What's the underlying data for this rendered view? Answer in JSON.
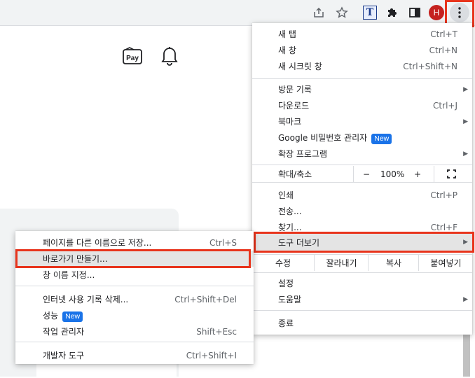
{
  "toolbar": {
    "icons": [
      "share-icon",
      "star-icon",
      "translate-extension-icon",
      "extensions-puzzle-icon",
      "side-panel-icon"
    ],
    "avatar_letter": "H",
    "menu_icon": "kebab-menu-icon",
    "translate_letter": "T"
  },
  "page": {
    "pay_label": "Pay"
  },
  "main_menu": {
    "new_tab": {
      "label": "새 탭",
      "shortcut": "Ctrl+T"
    },
    "new_window": {
      "label": "새 창",
      "shortcut": "Ctrl+N"
    },
    "incognito": {
      "label": "새 시크릿 창",
      "shortcut": "Ctrl+Shift+N"
    },
    "history": {
      "label": "방문 기록"
    },
    "downloads": {
      "label": "다운로드",
      "shortcut": "Ctrl+J"
    },
    "bookmarks": {
      "label": "북마크"
    },
    "password_manager": {
      "label": "Google 비밀번호 관리자",
      "badge": "New"
    },
    "extensions": {
      "label": "확장 프로그램"
    },
    "zoom": {
      "label": "확대/축소",
      "minus": "−",
      "value": "100%",
      "plus": "+"
    },
    "print": {
      "label": "인쇄",
      "shortcut": "Ctrl+P"
    },
    "cast": {
      "label": "전송..."
    },
    "find": {
      "label": "찾기...",
      "shortcut": "Ctrl+F"
    },
    "more_tools": {
      "label": "도구 더보기"
    },
    "edit": {
      "label": "수정",
      "cut": "잘라내기",
      "copy": "복사",
      "paste": "붙여넣기"
    },
    "settings": {
      "label": "설정"
    },
    "help": {
      "label": "도움말"
    },
    "exit": {
      "label": "종료"
    }
  },
  "sub_menu": {
    "save_page": {
      "label": "페이지를 다른 이름으로 저장...",
      "shortcut": "Ctrl+S"
    },
    "create_shortcut": {
      "label": "바로가기 만들기..."
    },
    "name_window": {
      "label": "창 이름 지정..."
    },
    "clear_data": {
      "label": "인터넷 사용 기록 삭제...",
      "shortcut": "Ctrl+Shift+Del"
    },
    "performance": {
      "label": "성능",
      "badge": "New"
    },
    "task_manager": {
      "label": "작업 관리자",
      "shortcut": "Shift+Esc"
    },
    "dev_tools": {
      "label": "개발자 도구",
      "shortcut": "Ctrl+Shift+I"
    }
  },
  "colors": {
    "highlight_border": "#e8341c",
    "badge": "#1a73e8",
    "avatar": "#c5221f"
  }
}
